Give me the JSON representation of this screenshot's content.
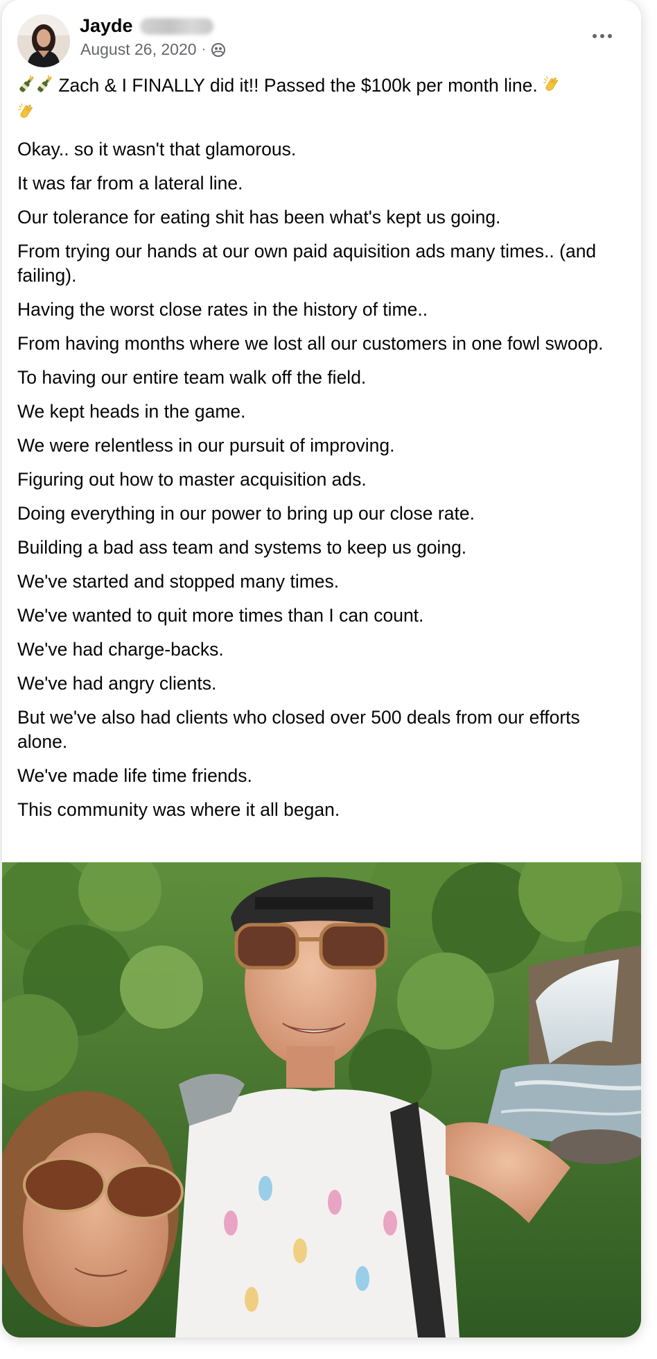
{
  "post": {
    "author_first": "Jayde",
    "date": "August 26, 2020",
    "separator": "·",
    "privacy_icon": "group-members-icon",
    "more_icon": "more-options-icon",
    "first_line_text": " Zach & I FINALLY did it!! Passed the $100k per month line. ",
    "paragraphs": [
      "Okay.. so it wasn't that glamorous.",
      "It was far from a lateral line.",
      "Our tolerance for eating shit has been what's kept us going.",
      "From trying our hands at our own paid aquisition ads many times.. (and failing).",
      "Having the worst close rates in the history of time..",
      "From having months where we lost all our customers in one fowl swoop.",
      "To having our entire team walk off the field.",
      "We kept heads in the game.",
      "We were relentless in our pursuit of improving.",
      "Figuring out how to master acquisition ads.",
      "Doing everything in our power to bring up our close rate.",
      "Building a bad ass team and systems to keep us going.",
      "We've started and stopped many times.",
      "We've wanted to quit more times than I can count.",
      "We've had charge-backs.",
      "We've had angry clients.",
      "But we've also had clients who closed over 500 deals from our efforts alone.",
      "We've made life time friends."
    ],
    "last_line": {
      "before": "This",
      "highlight": "community",
      "after": " was where it all began."
    },
    "photo_description_icon": "photo"
  },
  "colors": {
    "text": "#050505",
    "secondary": "#65676b"
  }
}
